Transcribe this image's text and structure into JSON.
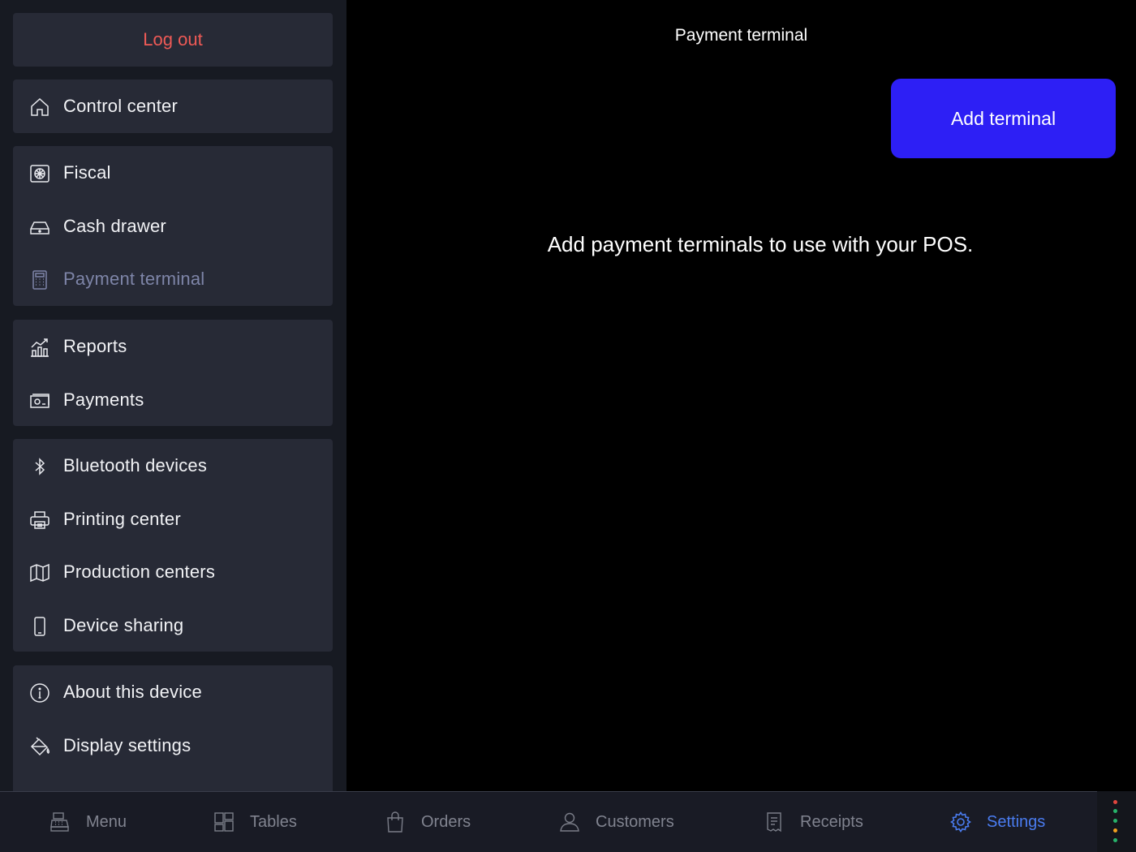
{
  "sidebar": {
    "logout_label": "Log out",
    "groups": [
      {
        "items": [
          {
            "label": "Control center",
            "icon": "home-icon"
          }
        ]
      },
      {
        "items": [
          {
            "label": "Fiscal",
            "icon": "fiscal-icon"
          },
          {
            "label": "Cash drawer",
            "icon": "cash-drawer-icon"
          },
          {
            "label": "Payment terminal",
            "icon": "calculator-icon",
            "active": true
          }
        ]
      },
      {
        "items": [
          {
            "label": "Reports",
            "icon": "chart-icon"
          },
          {
            "label": "Payments",
            "icon": "banknote-icon"
          }
        ]
      },
      {
        "items": [
          {
            "label": "Bluetooth devices",
            "icon": "bluetooth-icon"
          },
          {
            "label": "Printing center",
            "icon": "printer-icon"
          },
          {
            "label": "Production centers",
            "icon": "map-icon"
          },
          {
            "label": "Device sharing",
            "icon": "phone-icon"
          }
        ]
      },
      {
        "items": [
          {
            "label": "About this device",
            "icon": "info-icon"
          },
          {
            "label": "Display settings",
            "icon": "paint-bucket-icon"
          }
        ]
      }
    ]
  },
  "main": {
    "title": "Payment terminal",
    "add_button_label": "Add terminal",
    "empty_message": "Add payment terminals to use with your POS."
  },
  "tabbar": {
    "tabs": [
      {
        "label": "Menu",
        "icon": "cash-register-icon"
      },
      {
        "label": "Tables",
        "icon": "tables-grid-icon"
      },
      {
        "label": "Orders",
        "icon": "shopping-bag-icon"
      },
      {
        "label": "Customers",
        "icon": "user-icon"
      },
      {
        "label": "Receipts",
        "icon": "receipt-icon"
      },
      {
        "label": "Settings",
        "icon": "gear-icon",
        "active": true
      }
    ],
    "accent_color": "#4a7cf0"
  },
  "colors": {
    "logout": "#ef5a56",
    "add_button": "#2d1ff5",
    "status_dots": [
      "#e0463e",
      "#27b36a",
      "#27b36a",
      "#f0a020",
      "#27b36a"
    ]
  }
}
